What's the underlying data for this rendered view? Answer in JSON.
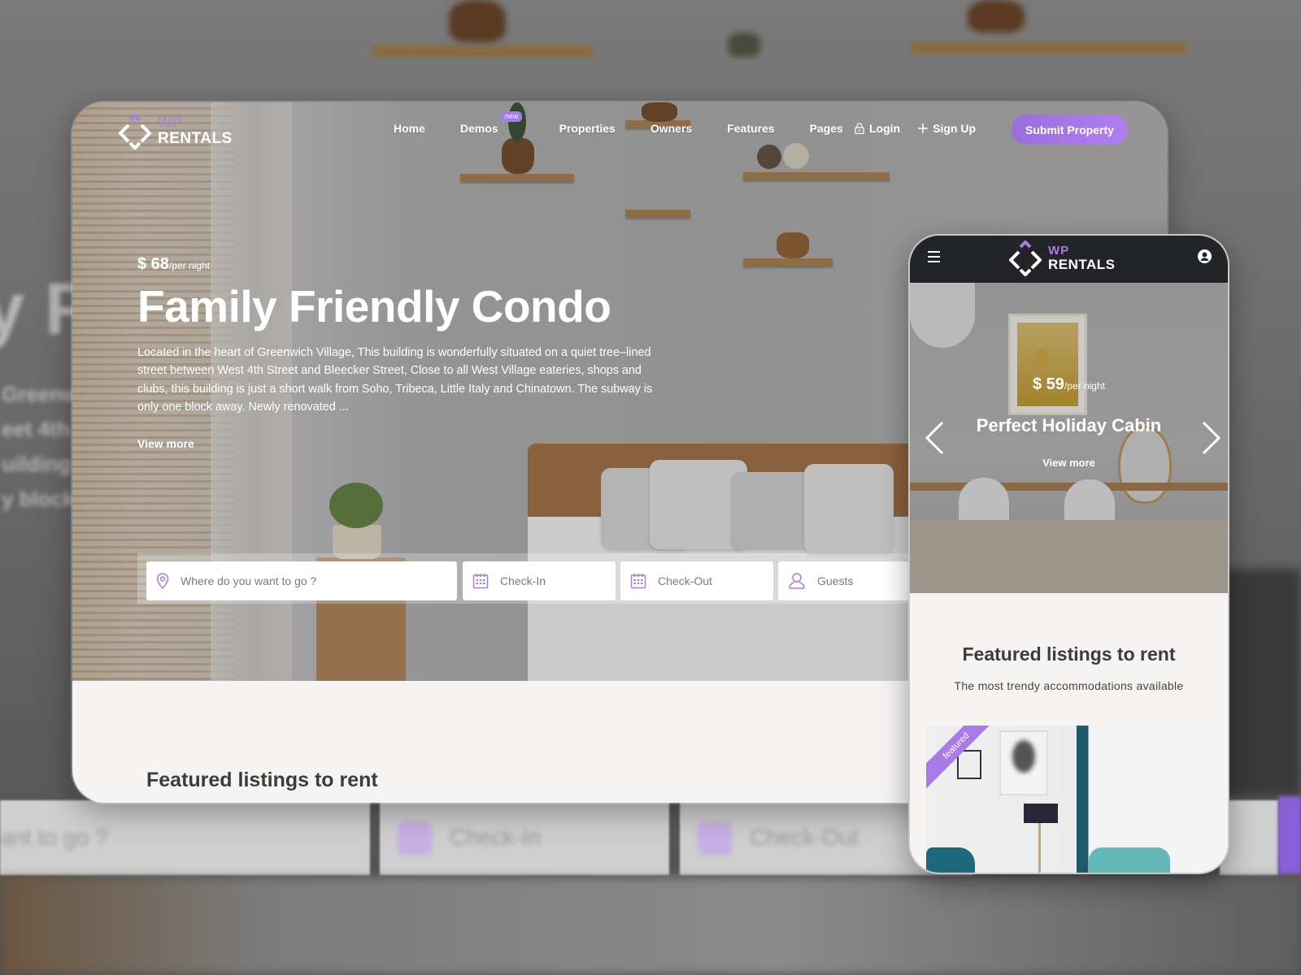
{
  "brand": {
    "wp": "WP",
    "rentals": "RENTALS",
    "accent": "#a97be6",
    "dark_header": "#232427"
  },
  "nav": {
    "items": [
      {
        "label": "Home"
      },
      {
        "label": "Demos",
        "badge": "new"
      },
      {
        "label": "Properties"
      },
      {
        "label": "Owners"
      },
      {
        "label": "Features"
      },
      {
        "label": "Pages"
      }
    ],
    "login": "Login",
    "signup": "Sign Up",
    "submit": "Submit Property"
  },
  "hero": {
    "price": "$ 68",
    "per_night": "/per night",
    "title": "Family Friendly Condo",
    "description": "Located in the heart of Greenwich Village, This building is wonderfully situated on a quiet tree–lined street between West 4th Street and Bleecker Street, Close to all West Village eateries, shops and clubs, this building is just a short walk from Soho, Tribeca, Little Italy and Chinatown. The subway is only one block away. Newly renovated ...",
    "view_more": "View more"
  },
  "search": {
    "location_placeholder": "Where do you want to go ?",
    "checkin_placeholder": "Check-In",
    "checkout_placeholder": "Check-Out",
    "guests_placeholder": "Guests"
  },
  "featured": {
    "title": "Featured listings to rent"
  },
  "mobile": {
    "price": "$ 59",
    "per_night": "/per night",
    "title": "Perfect Holiday Cabin",
    "view_more": "View more",
    "section_title": "Featured listings to rent",
    "section_subtitle": "The most trendy accommodations available",
    "ribbon": "featured"
  },
  "background": {
    "ghost_title": "y F",
    "ghost_lines": [
      "Greenw",
      "eet 4th",
      "uilding",
      "y block"
    ],
    "ghost_search": [
      "ant to go ?",
      "Check-In",
      "Check-Out"
    ]
  }
}
